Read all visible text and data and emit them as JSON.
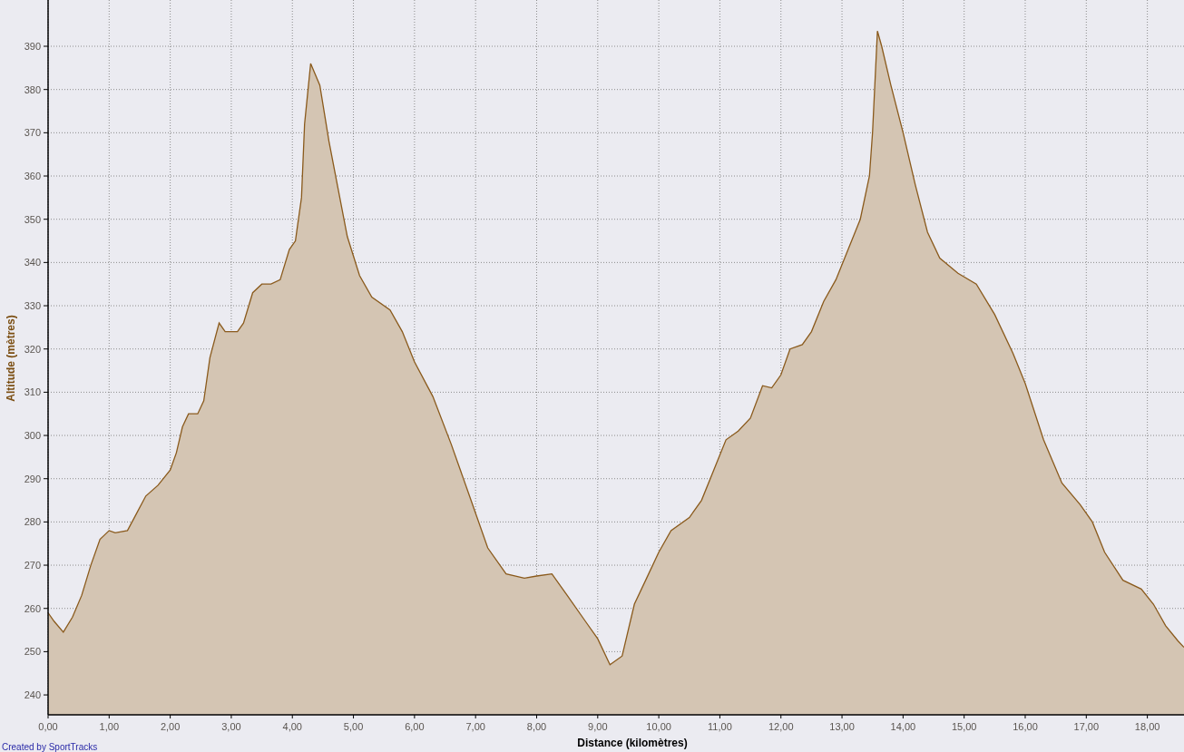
{
  "chart_data": {
    "type": "area",
    "xlabel": "Distance (kilomètres)",
    "ylabel": "Altitude (mètres)",
    "x": [
      0,
      0.1,
      0.25,
      0.4,
      0.55,
      0.7,
      0.85,
      1.0,
      1.1,
      1.3,
      1.45,
      1.6,
      1.8,
      2.0,
      2.1,
      2.2,
      2.3,
      2.45,
      2.55,
      2.65,
      2.8,
      2.9,
      3.1,
      3.2,
      3.35,
      3.5,
      3.65,
      3.8,
      3.95,
      4.05,
      4.15,
      4.2,
      4.3,
      4.45,
      4.6,
      4.75,
      4.9,
      5.1,
      5.3,
      5.6,
      5.8,
      6.0,
      6.3,
      6.6,
      6.9,
      7.2,
      7.5,
      7.8,
      8.0,
      8.25,
      8.5,
      8.8,
      9.0,
      9.2,
      9.4,
      9.6,
      9.8,
      10.0,
      10.2,
      10.5,
      10.7,
      10.9,
      11.1,
      11.3,
      11.5,
      11.7,
      11.85,
      12.0,
      12.15,
      12.35,
      12.5,
      12.7,
      12.9,
      13.1,
      13.3,
      13.45,
      13.5,
      13.58,
      13.65,
      13.8,
      14.0,
      14.2,
      14.4,
      14.6,
      14.9,
      15.2,
      15.5,
      15.8,
      16.0,
      16.3,
      16.6,
      16.9,
      17.1,
      17.3,
      17.6,
      17.9,
      18.1,
      18.3,
      18.5,
      18.6
    ],
    "values": [
      259,
      257,
      254.5,
      258,
      263,
      270,
      276,
      278,
      277.5,
      278,
      282,
      286,
      288.5,
      292,
      296,
      302,
      305,
      305,
      308,
      318,
      326,
      324,
      324,
      326,
      333,
      335,
      335,
      336,
      343,
      345,
      355,
      372,
      386,
      381,
      368,
      357,
      346,
      337,
      332,
      329,
      324,
      317,
      309,
      298,
      286,
      274,
      268,
      267,
      267.5,
      268,
      263,
      257,
      253,
      247,
      249,
      261,
      267,
      273,
      278,
      281,
      285,
      292,
      299,
      301,
      304,
      311.5,
      311,
      314,
      320,
      321,
      324,
      331,
      336,
      343,
      350,
      360,
      370,
      393.5,
      390,
      381,
      370,
      358,
      347,
      341,
      337.5,
      335,
      328,
      319,
      312,
      299,
      289,
      284,
      280,
      273,
      266.5,
      264.5,
      261,
      256,
      252.5,
      251
    ],
    "grid": true,
    "xlim": [
      0,
      18.6
    ],
    "ylim": [
      235.4,
      400.7
    ],
    "xticks": [
      {
        "value": 0,
        "label": "0,00"
      },
      {
        "value": 1,
        "label": "1,00"
      },
      {
        "value": 2,
        "label": "2,00"
      },
      {
        "value": 3,
        "label": "3,00"
      },
      {
        "value": 4,
        "label": "4,00"
      },
      {
        "value": 5,
        "label": "5,00"
      },
      {
        "value": 6,
        "label": "6,00"
      },
      {
        "value": 7,
        "label": "7,00"
      },
      {
        "value": 8,
        "label": "8,00"
      },
      {
        "value": 9,
        "label": "9,00"
      },
      {
        "value": 10,
        "label": "10,00"
      },
      {
        "value": 11,
        "label": "11,00"
      },
      {
        "value": 12,
        "label": "12,00"
      },
      {
        "value": 13,
        "label": "13,00"
      },
      {
        "value": 14,
        "label": "14,00"
      },
      {
        "value": 15,
        "label": "15,00"
      },
      {
        "value": 16,
        "label": "16,00"
      },
      {
        "value": 17,
        "label": "17,00"
      },
      {
        "value": 18,
        "label": "18,00"
      }
    ],
    "yticks": [
      240,
      250,
      260,
      270,
      280,
      290,
      300,
      310,
      320,
      330,
      340,
      350,
      360,
      370,
      380,
      390
    ]
  },
  "credit": "Created by SportTracks"
}
